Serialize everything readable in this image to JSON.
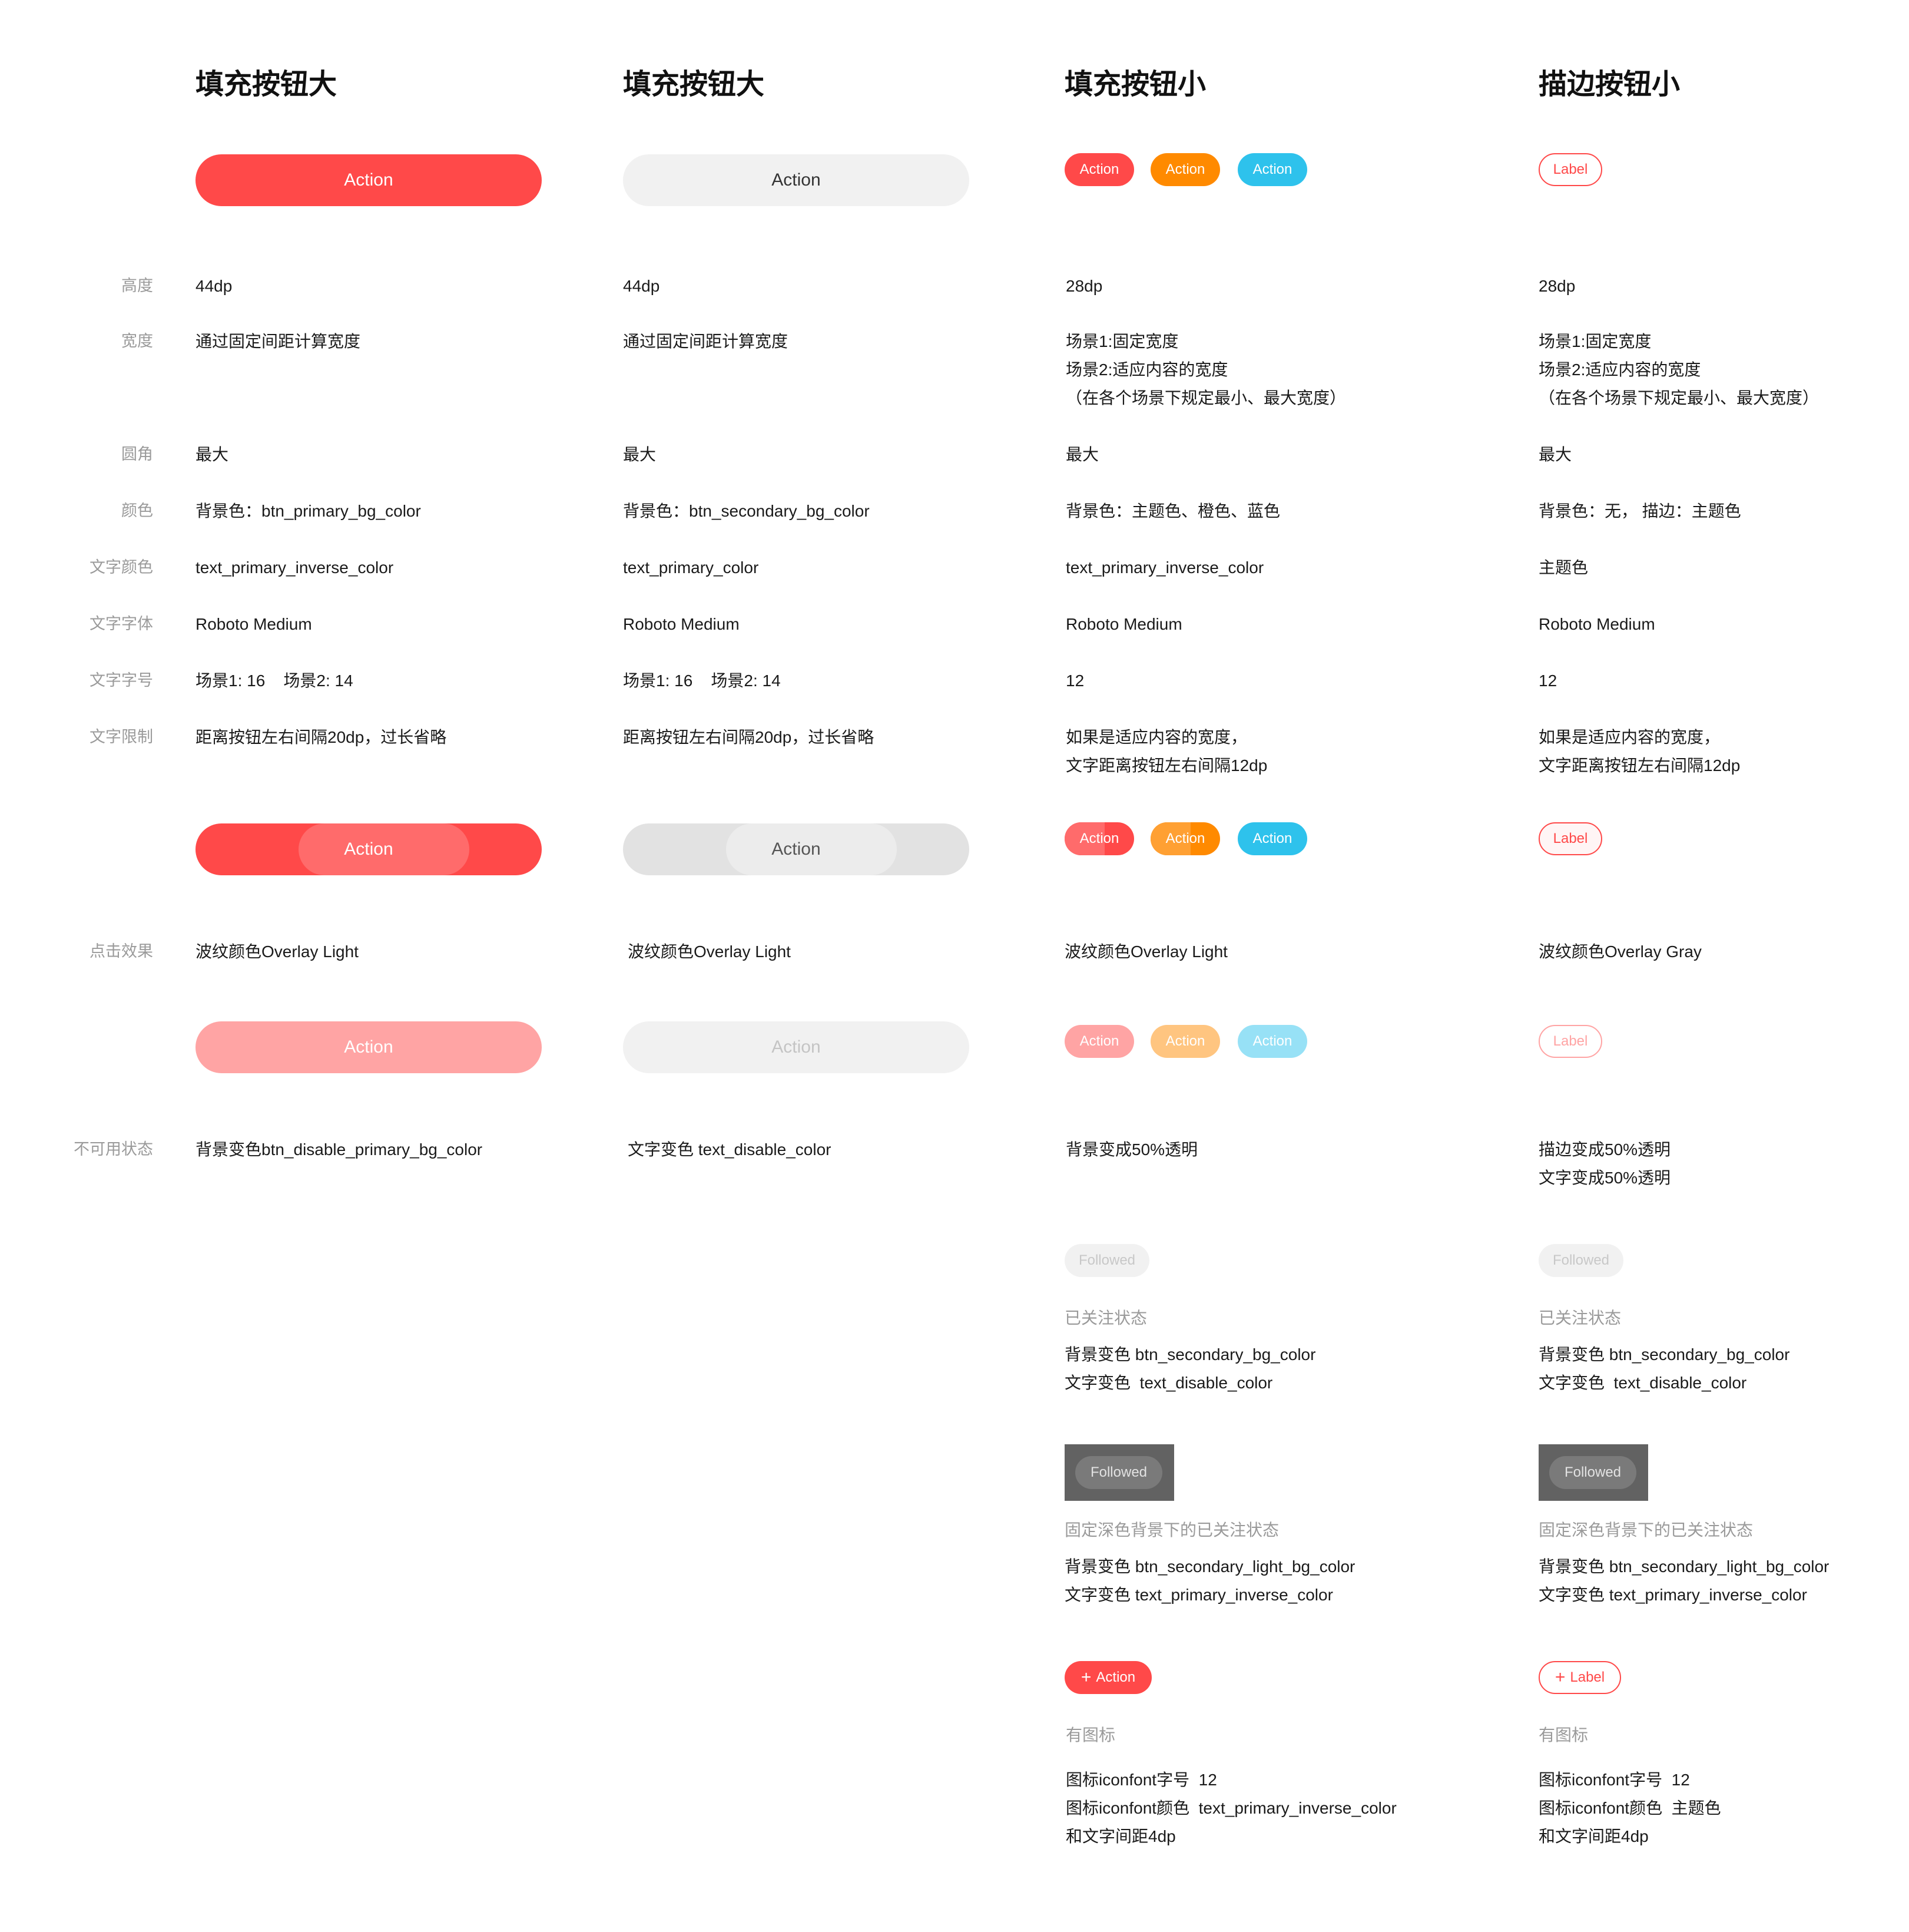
{
  "columns": {
    "fill_large_primary": {
      "title": "填充按钮大"
    },
    "fill_large_secondary": {
      "title": "填充按钮大"
    },
    "fill_small": {
      "title": "填充按钮小"
    },
    "outline_small": {
      "title": "描边按钮小"
    }
  },
  "row_labels": {
    "height": "高度",
    "width": "宽度",
    "corner": "圆角",
    "color": "颜色",
    "text_color": "文字颜色",
    "text_font": "文字字体",
    "text_size": "文字字号",
    "text_limit": "文字限制",
    "press": "点击效果",
    "disabled": "不可用状态"
  },
  "buttons": {
    "action": "Action",
    "label": "Label",
    "followed": "Followed",
    "plus": "+"
  },
  "col1": {
    "height": "44dp",
    "width": "通过固定间距计算宽度",
    "corner": "最大",
    "color": "背景色：btn_primary_bg_color",
    "text_color": "text_primary_inverse_color",
    "text_font": "Roboto Medium",
    "text_size": "场景1: 16    场景2: 14",
    "text_limit": "距离按钮左右间隔20dp，过长省略",
    "press": "波纹颜色Overlay Light",
    "disabled": "背景变色btn_disable_primary_bg_color"
  },
  "col2": {
    "height": "44dp",
    "width": "通过固定间距计算宽度",
    "corner": "最大",
    "color": "背景色：btn_secondary_bg_color",
    "text_color": "text_primary_color",
    "text_font": "Roboto Medium",
    "text_size": "场景1: 16    场景2: 14",
    "text_limit": "距离按钮左右间隔20dp，过长省略",
    "press": "波纹颜色Overlay Light",
    "disabled": "文字变色 text_disable_color"
  },
  "col3": {
    "height": "28dp",
    "width_1": "场景1:固定宽度",
    "width_2": "场景2:适应内容的宽度",
    "width_3": "（在各个场景下规定最小、最大宽度）",
    "corner": "最大",
    "color": "背景色：主题色、橙色、蓝色",
    "text_color": "text_primary_inverse_color",
    "text_font": "Roboto Medium",
    "text_size": "12",
    "text_limit_1": "如果是适应内容的宽度，",
    "text_limit_2": "文字距离按钮左右间隔12dp",
    "press": "波纹颜色Overlay Light",
    "disabled": "背景变成50%透明",
    "followed_title": "已关注状态",
    "followed_1": "背景变色 btn_secondary_bg_color",
    "followed_2": "文字变色  text_disable_color",
    "dark_title": "固定深色背景下的已关注状态",
    "dark_1": "背景变色 btn_secondary_light_bg_color",
    "dark_2": "文字变色 text_primary_inverse_color",
    "icon_title": "有图标",
    "icon_1": "图标iconfont字号  12",
    "icon_2": "图标iconfont颜色  text_primary_inverse_color",
    "icon_3": "和文字间距4dp"
  },
  "col4": {
    "height": "28dp",
    "width_1": "场景1:固定宽度",
    "width_2": "场景2:适应内容的宽度",
    "width_3": "（在各个场景下规定最小、最大宽度）",
    "corner": "最大",
    "color": "背景色：无， 描边：主题色",
    "text_color": "主题色",
    "text_font": "Roboto Medium",
    "text_size": "12",
    "text_limit_1": "如果是适应内容的宽度，",
    "text_limit_2": "文字距离按钮左右间隔12dp",
    "press": "波纹颜色Overlay Gray",
    "disabled_1": "描边变成50%透明",
    "disabled_2": "文字变成50%透明",
    "followed_title": "已关注状态",
    "followed_1": "背景变色 btn_secondary_bg_color",
    "followed_2": "文字变色  text_disable_color",
    "dark_title": "固定深色背景下的已关注状态",
    "dark_1": "背景变色 btn_secondary_light_bg_color",
    "dark_2": "文字变色 text_primary_inverse_color",
    "icon_title": "有图标",
    "icon_1": "图标iconfont字号  12",
    "icon_2": "图标iconfont颜色  主题色",
    "icon_3": "和文字间距4dp"
  },
  "colors": {
    "primary": "#ff4949",
    "orange": "#ff8a00",
    "blue": "#2ec2ec",
    "secondary_bg": "#f1f1f1",
    "dark_bg": "#626262"
  }
}
